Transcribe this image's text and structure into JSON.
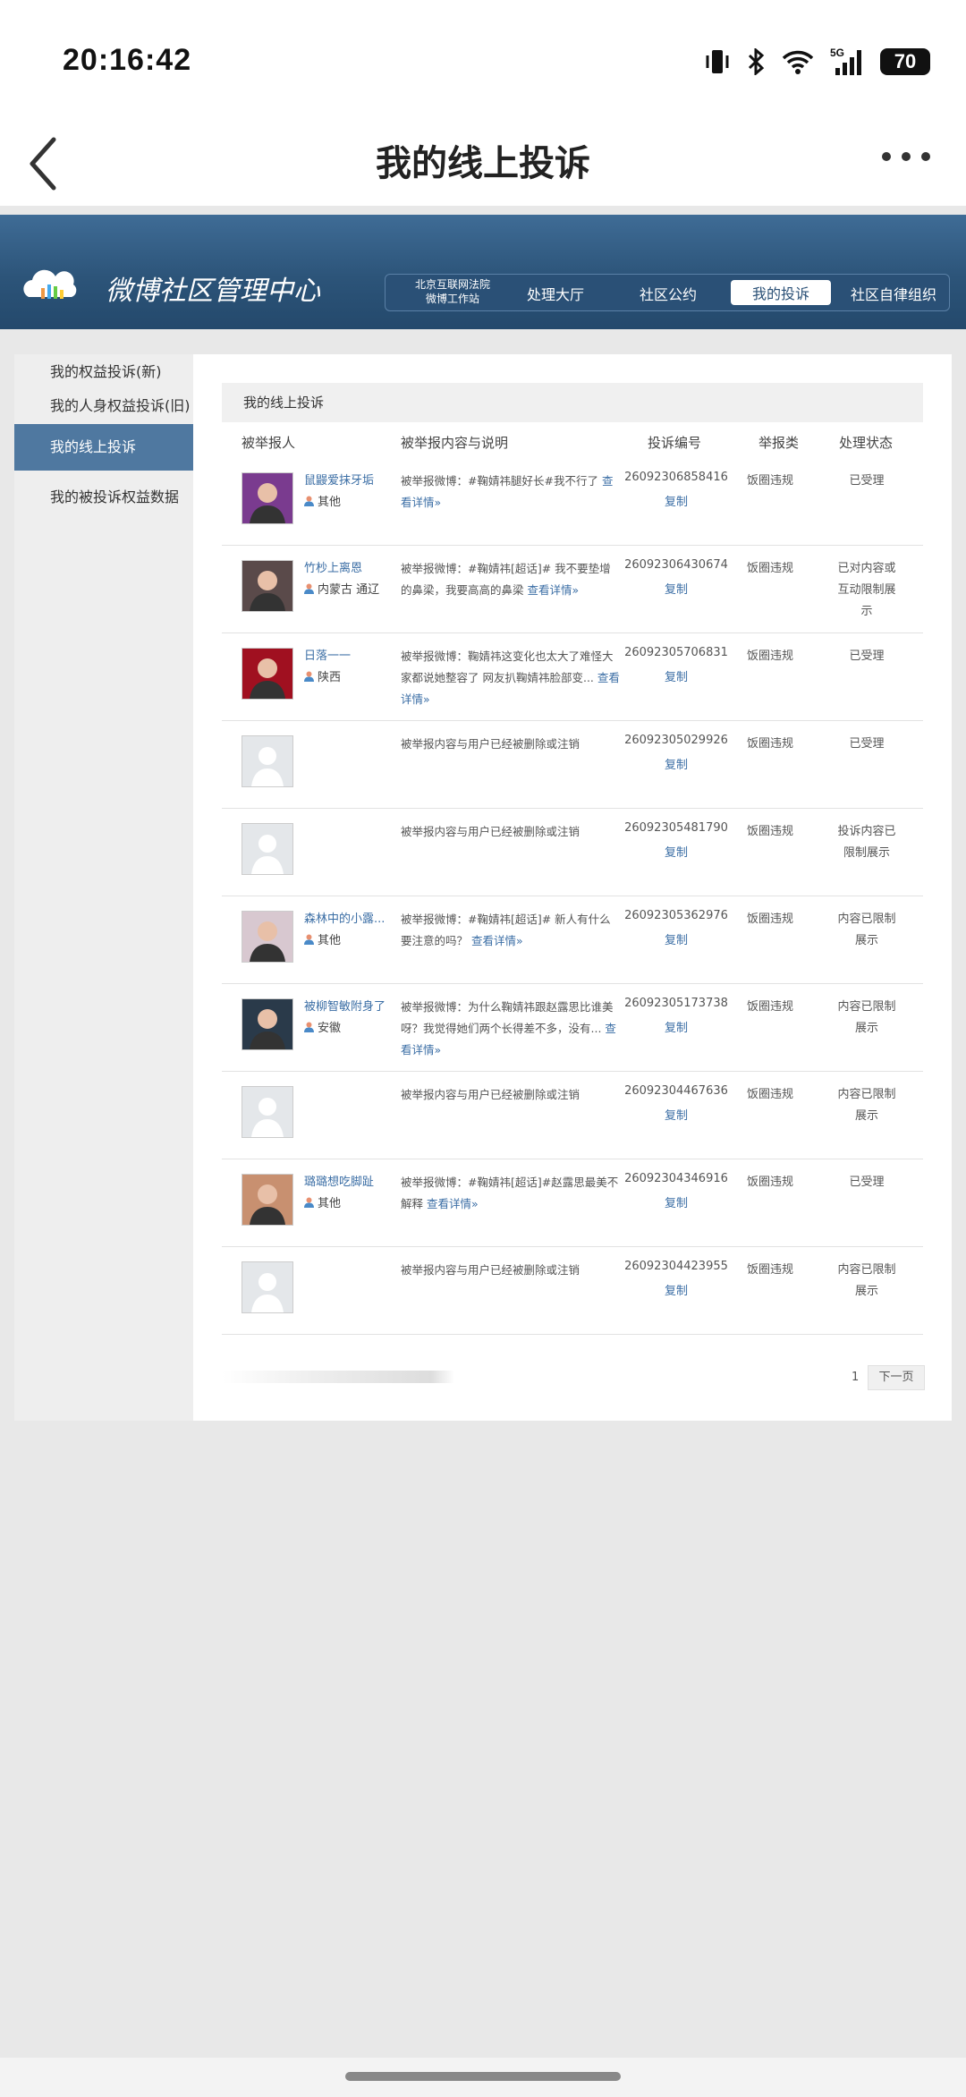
{
  "statusbar": {
    "time": "20:16:42",
    "network": "5G",
    "battery": "70"
  },
  "navbar": {
    "title": "我的线上投诉"
  },
  "banner": {
    "site_title": "微博社区管理中心",
    "court_line1": "北京互联网法院",
    "court_line2": "微博工作站",
    "nav": [
      "处理大厅",
      "社区公约",
      "我的投诉",
      "社区自律组织"
    ]
  },
  "sidebar": {
    "items": [
      "我的权益投诉(新)",
      "我的人身权益投诉(旧)",
      "我的线上投诉",
      "我的被投诉权益数据"
    ]
  },
  "content": {
    "heading": "我的线上投诉",
    "columns": [
      "被举报人",
      "被举报内容与说明",
      "投诉编号",
      "举报类",
      "处理状态"
    ],
    "copy_label": "复制",
    "rows": [
      {
        "name": "鼠鼹爱抹牙垢",
        "loc": "其他",
        "desc": "被举报微博：#鞠婧祎腿好长#我不行了",
        "more": "查看详情»",
        "code": "26092306858416",
        "cat": "饭圈违规",
        "status": "已受理"
      },
      {
        "name": "竹杪上离恩",
        "loc": "内蒙古 通辽",
        "desc": "被举报微博：#鞠婧祎[超话]# 我不要垫增的鼻梁，我要高高的鼻梁",
        "more": "查看详情»",
        "code": "26092306430674",
        "cat": "饭圈违规",
        "status": "已对内容或互动限制展示"
      },
      {
        "name": "日落一一",
        "loc": "陕西",
        "desc": "被举报微博：鞠婧祎这变化也太大了难怪大家都说她整容了 网友扒鞠婧祎脸部变...",
        "more": "查看详情»",
        "code": "26092305706831",
        "cat": "饭圈违规",
        "status": "已受理"
      },
      {
        "name": "",
        "loc": "",
        "desc": "被举报内容与用户已经被删除或注销",
        "more": "",
        "code": "26092305029926",
        "cat": "饭圈违规",
        "status": "已受理"
      },
      {
        "name": "",
        "loc": "",
        "desc": "被举报内容与用户已经被删除或注销",
        "more": "",
        "code": "26092305481790",
        "cat": "饭圈违规",
        "status": "投诉内容已限制展示"
      },
      {
        "name": "森林中的小露...",
        "loc": "其他",
        "desc": "被举报微博：#鞠婧祎[超话]# 新人有什么要注意的吗？",
        "more": "查看详情»",
        "code": "26092305362976",
        "cat": "饭圈违规",
        "status": "内容已限制展示"
      },
      {
        "name": "被柳智敏附身了",
        "loc": "安徽",
        "desc": "被举报微博：为什么鞠婧祎跟赵露思比谁美呀？我觉得她们两个长得差不多，没有...",
        "more": "查看详情»",
        "code": "26092305173738",
        "cat": "饭圈违规",
        "status": "内容已限制展示"
      },
      {
        "name": "",
        "loc": "",
        "desc": "被举报内容与用户已经被删除或注销",
        "more": "",
        "code": "26092304467636",
        "cat": "饭圈违规",
        "status": "内容已限制展示"
      },
      {
        "name": "璐璐想吃脚趾",
        "loc": "其他",
        "desc": "被举报微博：#鞠婧祎[超话]#赵露思最美不解释",
        "more": "查看详情»",
        "code": "26092304346916",
        "cat": "饭圈违规",
        "status": "已受理"
      },
      {
        "name": "",
        "loc": "",
        "desc": "被举报内容与用户已经被删除或注销",
        "more": "",
        "code": "26092304423955",
        "cat": "饭圈违规",
        "status": "内容已限制展示"
      }
    ]
  },
  "pager": {
    "page": "1",
    "next": "下一页"
  }
}
